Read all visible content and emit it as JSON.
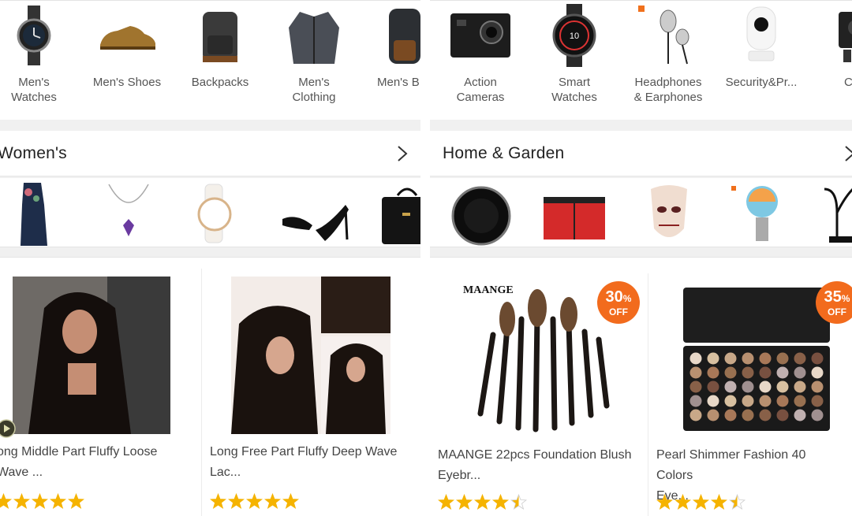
{
  "left": {
    "categories": [
      {
        "label": "Men's\nWatches",
        "icon": "watch-icon"
      },
      {
        "label": "Men's Shoes",
        "icon": "shoe-icon"
      },
      {
        "label": "Backpacks",
        "icon": "backpack-icon"
      },
      {
        "label": "Men's\nClothing",
        "icon": "jacket-icon"
      },
      {
        "label": "Men's B",
        "icon": "bag-icon"
      }
    ],
    "section_title": "Women's",
    "strip_items": [
      "dress-thumbnail",
      "necklace-thumbnail",
      "ladies-watch-thumbnail",
      "heels-thumbnail",
      "handbag-thumbnail"
    ],
    "products": [
      {
        "title": "ong Middle Part Fluffy Loose\nWave ...",
        "rating": 5
      },
      {
        "title": "Long Free Part Fluffy Deep Wave\nLac...",
        "rating": 5
      }
    ]
  },
  "right": {
    "categories": [
      {
        "label": "Action\nCameras",
        "icon": "action-camera-icon"
      },
      {
        "label": "Smart\nWatches",
        "icon": "smartwatch-icon"
      },
      {
        "label": "Headphones\n& Earphones",
        "icon": "earphones-icon"
      },
      {
        "label": "Security&Pr...",
        "icon": "security-camera-icon"
      },
      {
        "label": "C\nElect",
        "icon": "dash-camera-icon"
      }
    ],
    "section_title": "Home & Garden",
    "strip_items": [
      "robot-vacuum-thumbnail",
      "trunk-organizer-thumbnail",
      "mask-thumbnail",
      "smart-bulb-thumbnail",
      "jewelry-tree-thumbnail"
    ],
    "products": [
      {
        "title": "MAANGE 22pcs Foundation Blush\nEyebr...",
        "rating": 4.5,
        "discount": "30",
        "discount_unit": "%",
        "off_label": "OFF",
        "brand_text": "MAANGE"
      },
      {
        "title": "Pearl Shimmer Fashion 40 Colors\nEye...",
        "rating": 4.5,
        "discount": "35",
        "discount_unit": "%",
        "off_label": "OFF"
      }
    ]
  },
  "colors": {
    "star": "#f5b300",
    "badge": "#f26b1d",
    "divider": "#f0f0f0"
  }
}
